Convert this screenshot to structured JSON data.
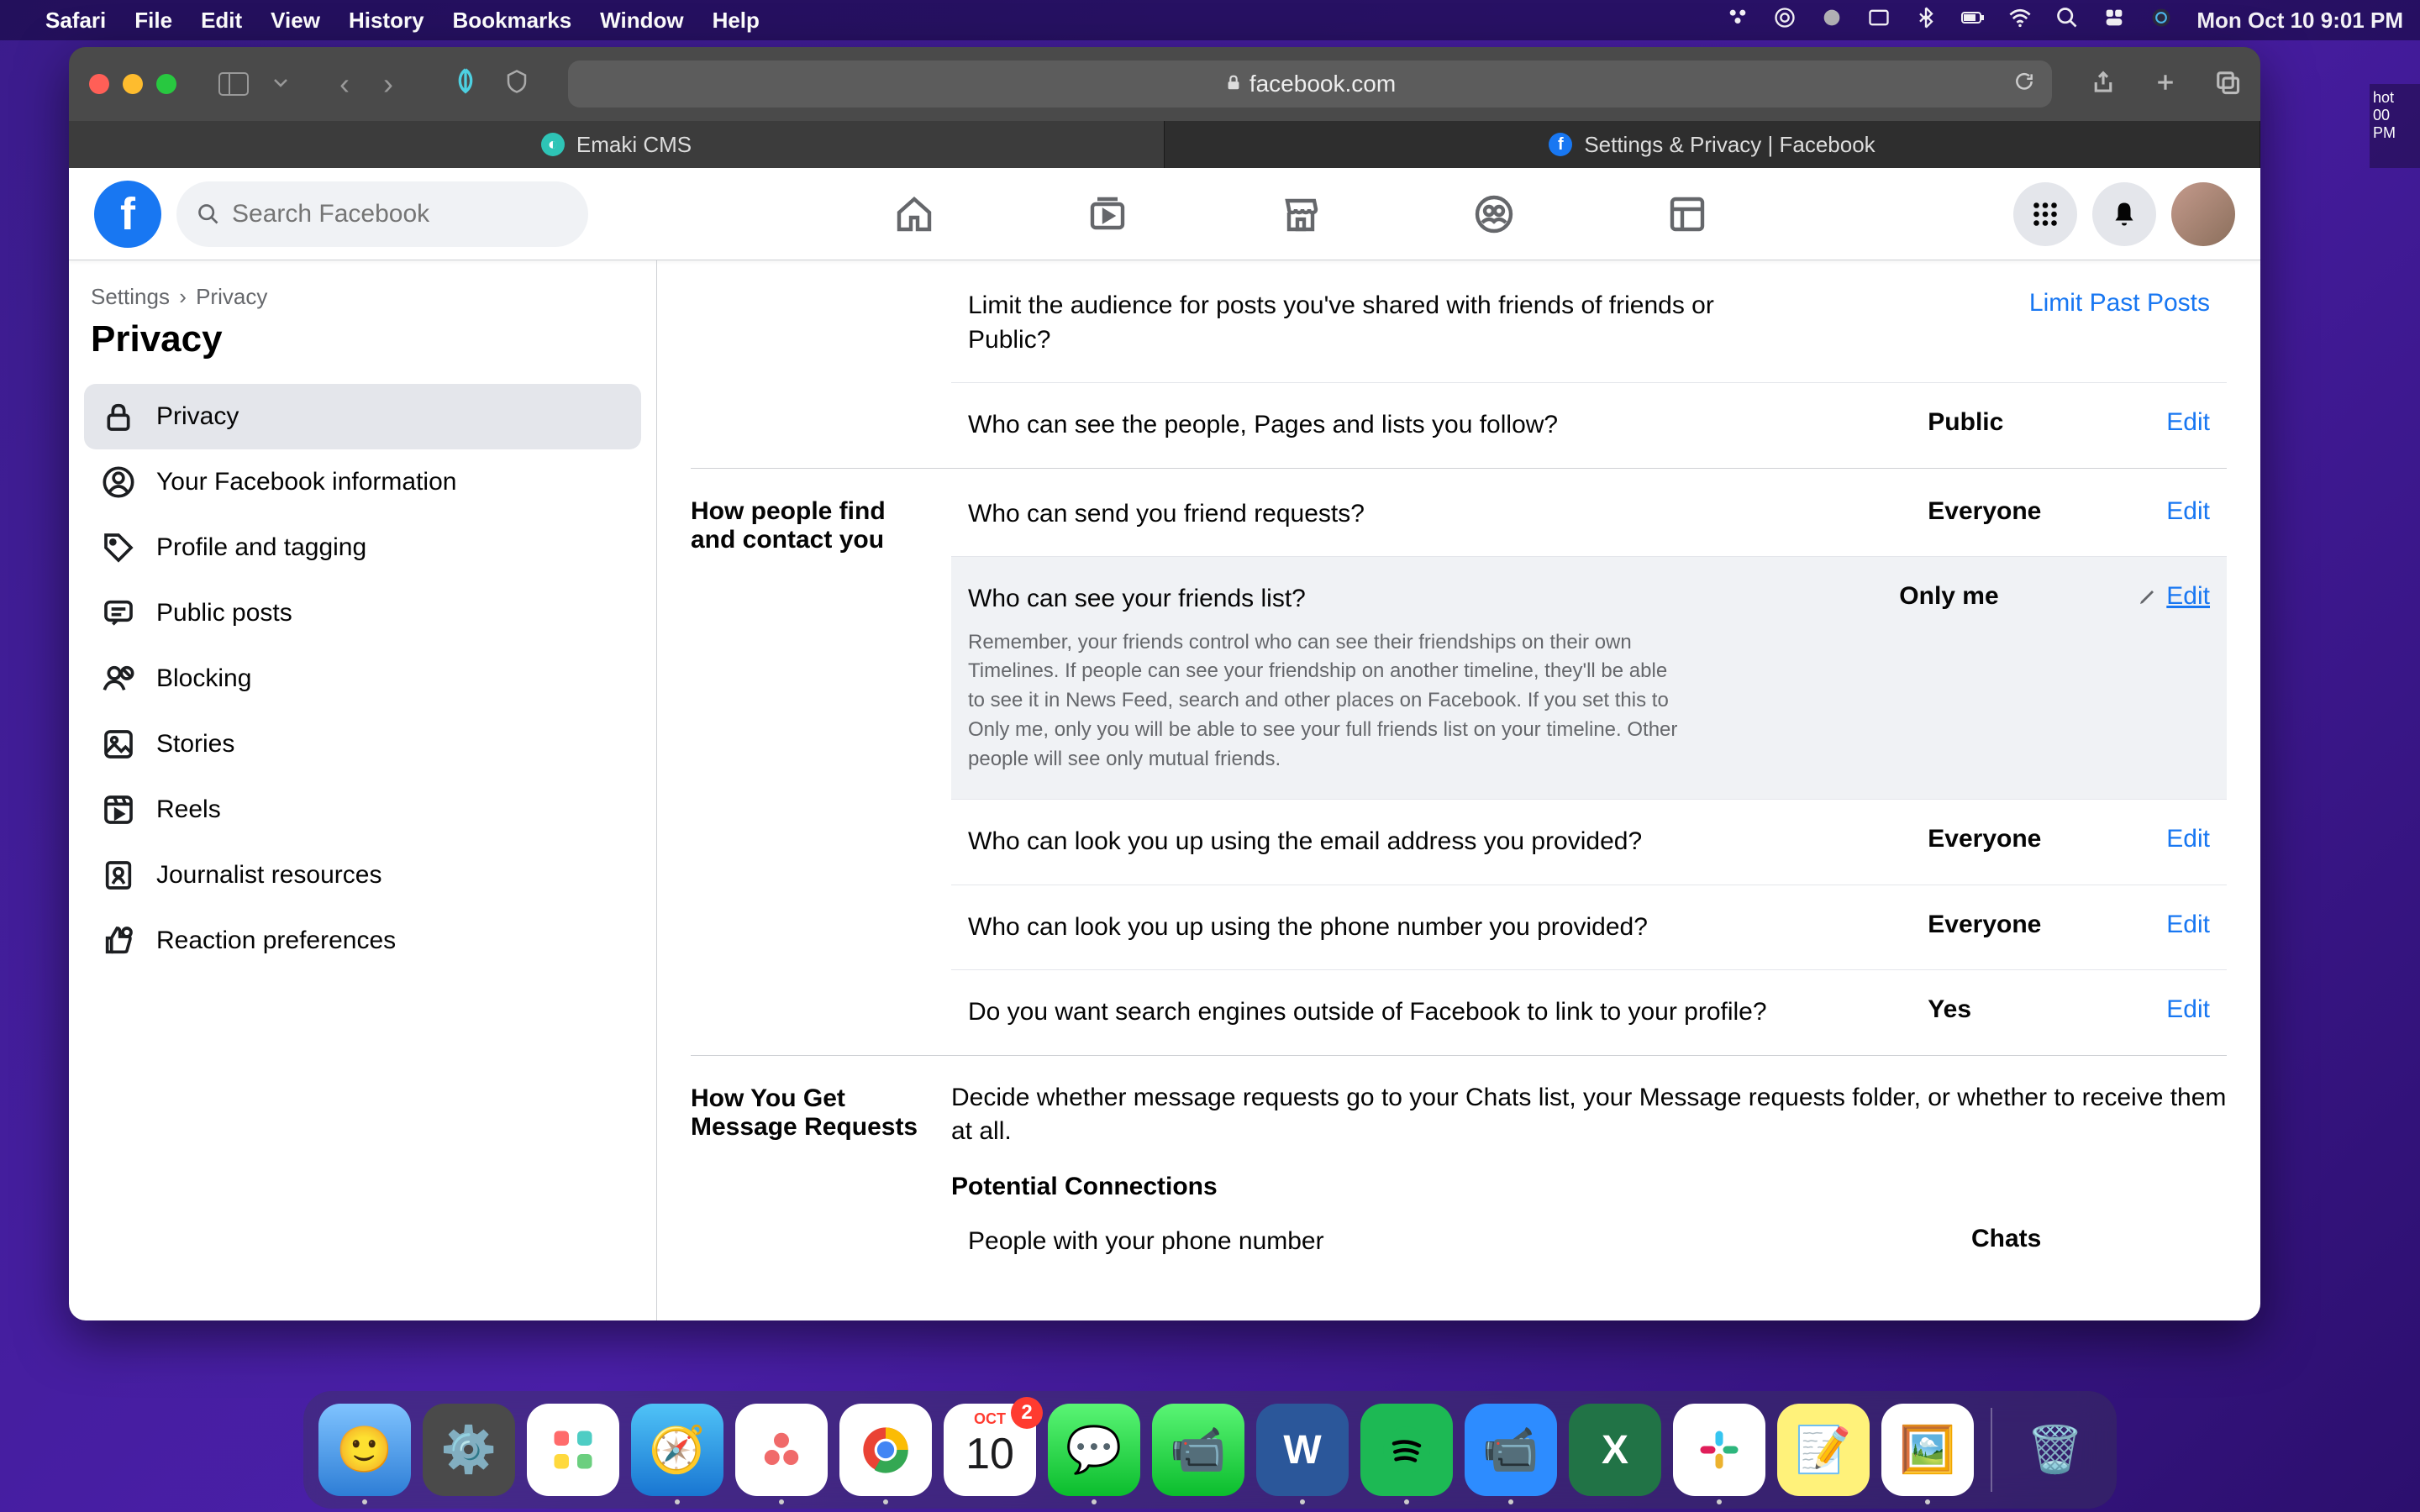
{
  "menubar": {
    "app": "Safari",
    "items": [
      "File",
      "Edit",
      "View",
      "History",
      "Bookmarks",
      "Window",
      "Help"
    ],
    "datetime": "Mon Oct 10  9:01 PM"
  },
  "safari": {
    "url": "facebook.com",
    "tabs": [
      {
        "label": "Emaki CMS"
      },
      {
        "label": "Settings & Privacy | Facebook"
      }
    ]
  },
  "fb_header": {
    "search_placeholder": "Search Facebook"
  },
  "sidebar": {
    "crumb1": "Settings",
    "crumb2": "Privacy",
    "title": "Privacy",
    "items": [
      "Privacy",
      "Your Facebook information",
      "Profile and tagging",
      "Public posts",
      "Blocking",
      "Stories",
      "Reels",
      "Journalist resources",
      "Reaction preferences"
    ]
  },
  "sections": {
    "activity": {
      "limit_title": "Limit the audience for posts you've shared with friends of friends or Public?",
      "limit_action": "Limit Past Posts",
      "follow_title": "Who can see the people, Pages and lists you follow?",
      "follow_value": "Public",
      "follow_action": "Edit"
    },
    "find_contact": {
      "label": "How people find and contact you",
      "r1_title": "Who can send you friend requests?",
      "r1_value": "Everyone",
      "r1_action": "Edit",
      "r2_title": "Who can see your friends list?",
      "r2_value": "Only me",
      "r2_action": "Edit",
      "r2_desc": "Remember, your friends control who can see their friendships on their own Timelines. If people can see your friendship on another timeline, they'll be able to see it in News Feed, search and other places on Facebook. If you set this to Only me, only you will be able to see your full friends list on your timeline. Other people will see only mutual friends.",
      "r3_title": "Who can look you up using the email address you provided?",
      "r3_value": "Everyone",
      "r3_action": "Edit",
      "r4_title": "Who can look you up using the phone number you provided?",
      "r4_value": "Everyone",
      "r4_action": "Edit",
      "r5_title": "Do you want search engines outside of Facebook to link to your profile?",
      "r5_value": "Yes",
      "r5_action": "Edit"
    },
    "messages": {
      "label": "How You Get Message Requests",
      "intro": "Decide whether message requests go to your Chats list, your Message requests folder, or whether to receive them at all.",
      "subhead": "Potential Connections",
      "r1_title": "People with your phone number",
      "r1_value": "Chats"
    }
  },
  "desktop_peek": {
    "l1": "hot",
    "l2": "00 PM"
  }
}
